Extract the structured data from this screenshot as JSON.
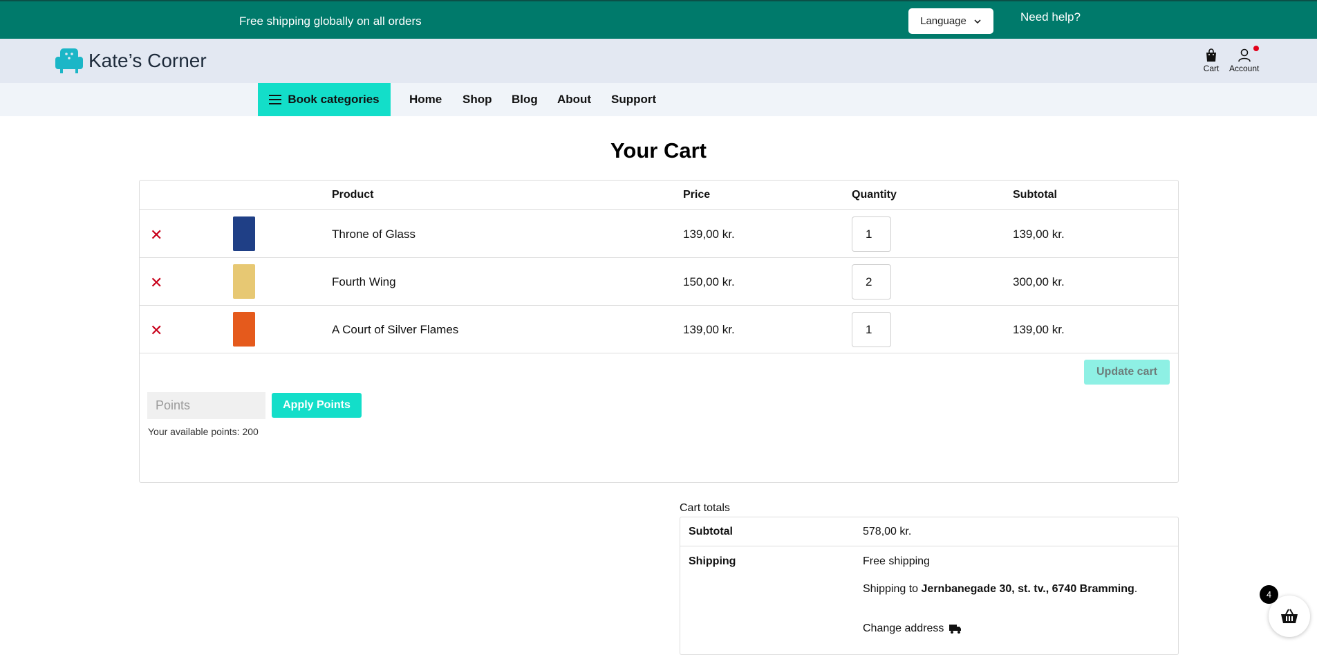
{
  "topbar": {
    "promo": "Free shipping globally on all orders",
    "language_label": "Language",
    "help_label": "Need help?"
  },
  "header": {
    "brand": "Kate’s Corner",
    "cart_label": "Cart",
    "account_label": "Account"
  },
  "nav": {
    "categories_label": "Book categories",
    "links": [
      "Home",
      "Shop",
      "Blog",
      "About",
      "Support"
    ]
  },
  "page": {
    "title": "Your Cart"
  },
  "cart": {
    "columns": {
      "product": "Product",
      "price": "Price",
      "quantity": "Quantity",
      "subtotal": "Subtotal"
    },
    "items": [
      {
        "name": "Throne of Glass",
        "price": "139,00 kr.",
        "quantity": "1",
        "subtotal": "139,00 kr.",
        "cover_color": "#1f3f86"
      },
      {
        "name": "Fourth Wing",
        "price": "150,00 kr.",
        "quantity": "2",
        "subtotal": "300,00 kr.",
        "cover_color": "#e7c873"
      },
      {
        "name": "A Court of Silver Flames",
        "price": "139,00 kr.",
        "quantity": "1",
        "subtotal": "139,00 kr.",
        "cover_color": "#e55a1c"
      }
    ],
    "update_label": "Update cart",
    "points_placeholder": "Points",
    "apply_label": "Apply Points",
    "available_points": "Your available points: 200"
  },
  "totals": {
    "title": "Cart totals",
    "subtotal_label": "Subtotal",
    "subtotal_value": "578,00 kr.",
    "shipping_label": "Shipping",
    "shipping_value": "Free shipping",
    "shipping_to_prefix": "Shipping to ",
    "shipping_address": "Jernbanegade 30, st. tv., 6740 Bramming",
    "shipping_to_suffix": ".",
    "change_address_label": "Change address"
  },
  "floating_basket": {
    "count": "4"
  },
  "colors": {
    "topbar": "#007a6b",
    "accent": "#13dec9",
    "header": "#e3e8f2",
    "remove": "#c8001a"
  }
}
